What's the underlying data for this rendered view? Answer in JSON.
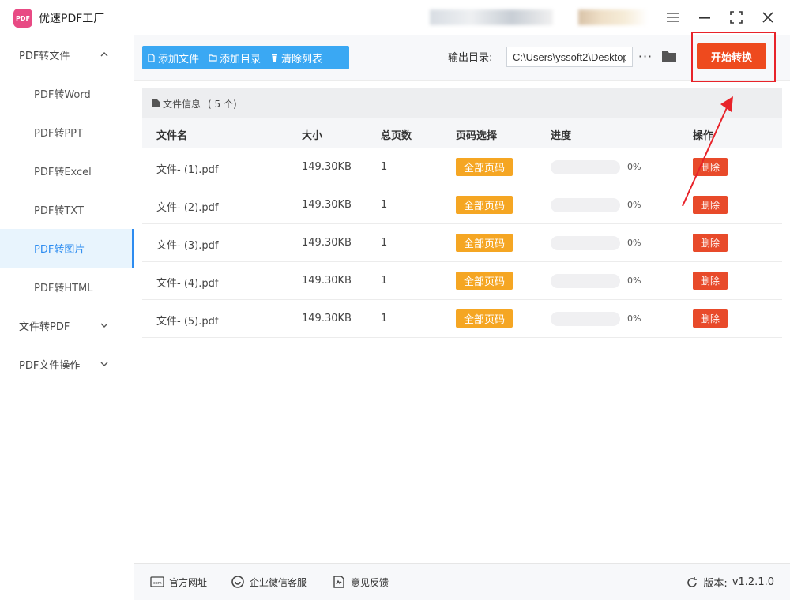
{
  "app": {
    "title": "优速PDF工厂",
    "logo_text": "PDF",
    "accent": "#2d8cf0",
    "brand": "#e84a84"
  },
  "sidebar": {
    "groups": [
      {
        "label": "PDF转文件",
        "expanded": true
      },
      {
        "label": "文件转PDF",
        "expanded": false
      },
      {
        "label": "PDF文件操作",
        "expanded": false
      }
    ],
    "items": [
      {
        "label": "PDF转Word"
      },
      {
        "label": "PDF转PPT"
      },
      {
        "label": "PDF转Excel"
      },
      {
        "label": "PDF转TXT"
      },
      {
        "label": "PDF转图片",
        "active": true
      },
      {
        "label": "PDF转HTML"
      }
    ]
  },
  "toolbar": {
    "add_file": "添加文件",
    "add_dir": "添加目录",
    "clear_list": "清除列表",
    "output_label": "输出目录:",
    "output_path": "C:\\Users\\yssoft2\\Desktop",
    "more": "···",
    "start": "开始转换",
    "start_color": "#ee4a1e"
  },
  "panel": {
    "info_label": "文件信息",
    "info_count": "( 5 个)",
    "columns": [
      "文件名",
      "大小",
      "总页数",
      "页码选择",
      "进度",
      "操作"
    ],
    "rows": [
      {
        "name": "文件- (1).pdf",
        "size": "149.30KB",
        "pages": "1",
        "page_select": "全部页码",
        "progress": 0,
        "progress_text": "0%",
        "action": "删除"
      },
      {
        "name": "文件- (2).pdf",
        "size": "149.30KB",
        "pages": "1",
        "page_select": "全部页码",
        "progress": 0,
        "progress_text": "0%",
        "action": "删除"
      },
      {
        "name": "文件- (3).pdf",
        "size": "149.30KB",
        "pages": "1",
        "page_select": "全部页码",
        "progress": 0,
        "progress_text": "0%",
        "action": "删除"
      },
      {
        "name": "文件- (4).pdf",
        "size": "149.30KB",
        "pages": "1",
        "page_select": "全部页码",
        "progress": 0,
        "progress_text": "0%",
        "action": "删除"
      },
      {
        "name": "文件- (5).pdf",
        "size": "149.30KB",
        "pages": "1",
        "page_select": "全部页码",
        "progress": 0,
        "progress_text": "0%",
        "action": "删除"
      }
    ]
  },
  "footer": {
    "website": "官方网址",
    "wechat": "企业微信客服",
    "feedback": "意见反馈",
    "version_label": "版本:",
    "version": "v1.2.1.0"
  },
  "icons": {
    "menu": "hamburger-icon",
    "minimize": "minimize-icon",
    "maximize": "maximize-icon",
    "close": "close-icon",
    "folder": "folder-icon",
    "refresh": "refresh-icon"
  }
}
